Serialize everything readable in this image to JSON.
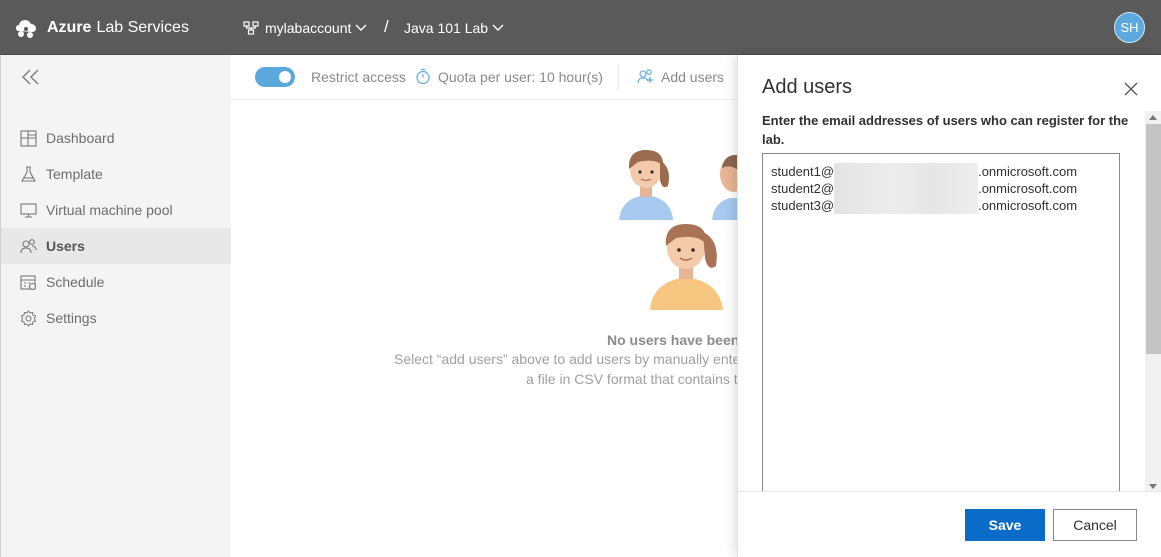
{
  "header": {
    "brand_bold": "Azure",
    "brand_rest": "Lab Services",
    "account": "mylabaccount",
    "separator": "/",
    "lab": "Java 101 Lab",
    "avatar_initials": "SH"
  },
  "sidebar": {
    "items": [
      {
        "label": "Dashboard",
        "icon": "dashboard-icon"
      },
      {
        "label": "Template",
        "icon": "flask-icon"
      },
      {
        "label": "Virtual machine pool",
        "icon": "monitor-icon"
      },
      {
        "label": "Users",
        "icon": "users-icon",
        "active": true
      },
      {
        "label": "Schedule",
        "icon": "calendar-icon"
      },
      {
        "label": "Settings",
        "icon": "gear-icon"
      }
    ]
  },
  "toolbar": {
    "restrict_access": "Restrict access",
    "restrict_access_on": true,
    "quota": "Quota per user: 10 hour(s)",
    "add_users": "Add users"
  },
  "empty_state": {
    "title": "No users have been",
    "desc1": "Select “add users” above to add users by manually ente",
    "desc2": "a file in CSV format that contains t"
  },
  "panel": {
    "title": "Add users",
    "description": "Enter the email addresses of users who can register for the lab.",
    "emails": [
      {
        "prefix": "student1@",
        "suffix": ".onmicrosoft.com"
      },
      {
        "prefix": "student2@",
        "suffix": ".onmicrosoft.com"
      },
      {
        "prefix": "student3@",
        "suffix": ".onmicrosoft.com"
      }
    ],
    "save_label": "Save",
    "cancel_label": "Cancel"
  },
  "colors": {
    "header_bg": "#5a5a5a",
    "accent": "#0a6cc8",
    "toggle": "#5ba8dd"
  }
}
